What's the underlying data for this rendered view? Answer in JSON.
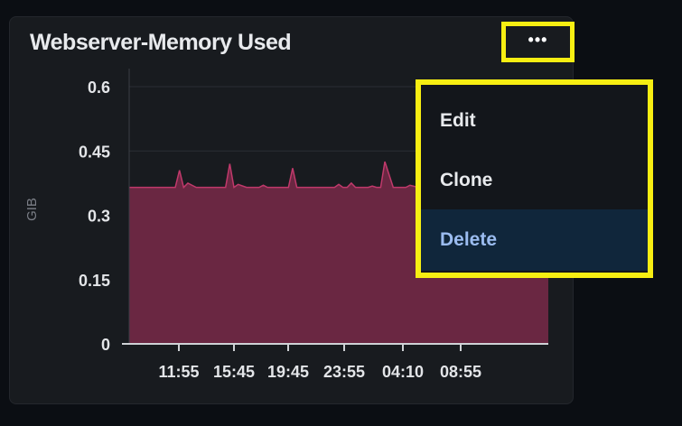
{
  "panel": {
    "title": "Webserver-Memory Used",
    "menu_trigger_label": "•••",
    "menu_trigger_icon": "more-horizontal-icon"
  },
  "chart_data": {
    "type": "area",
    "ylabel": "GIB",
    "ylim": [
      0,
      0.6
    ],
    "y_ticks": [
      "0",
      "0.15",
      "0.3",
      "0.45",
      "0.6"
    ],
    "x_ticks": [
      "11:55",
      "15:45",
      "19:45",
      "23:55",
      "04:10",
      "08:55"
    ],
    "series": [
      {
        "x": [
          0,
          0.11,
          0.12,
          0.13,
          0.14,
          0.16,
          0.23,
          0.24,
          0.25,
          0.26,
          0.28,
          0.31,
          0.32,
          0.33,
          0.38,
          0.39,
          0.4,
          0.41,
          0.43,
          0.49,
          0.5,
          0.51,
          0.52,
          0.53,
          0.54,
          0.55,
          0.57,
          0.58,
          0.59,
          0.6,
          0.61,
          0.63,
          0.64,
          0.65,
          0.66,
          0.67,
          0.69,
          0.7,
          0.71,
          1.0
        ],
        "y": [
          0.365,
          0.365,
          0.405,
          0.365,
          0.375,
          0.365,
          0.365,
          0.42,
          0.365,
          0.372,
          0.365,
          0.365,
          0.37,
          0.365,
          0.365,
          0.41,
          0.365,
          0.365,
          0.365,
          0.365,
          0.372,
          0.365,
          0.365,
          0.375,
          0.365,
          0.365,
          0.365,
          0.368,
          0.365,
          0.365,
          0.425,
          0.365,
          0.365,
          0.365,
          0.365,
          0.37,
          0.365,
          0.365,
          0.365,
          0.365
        ]
      }
    ],
    "colors": {
      "fill": "#6a2742",
      "line": "#c0396b"
    },
    "grid": true
  },
  "menu": {
    "items": [
      {
        "label": "Edit"
      },
      {
        "label": "Clone"
      },
      {
        "label": "Delete"
      }
    ]
  }
}
